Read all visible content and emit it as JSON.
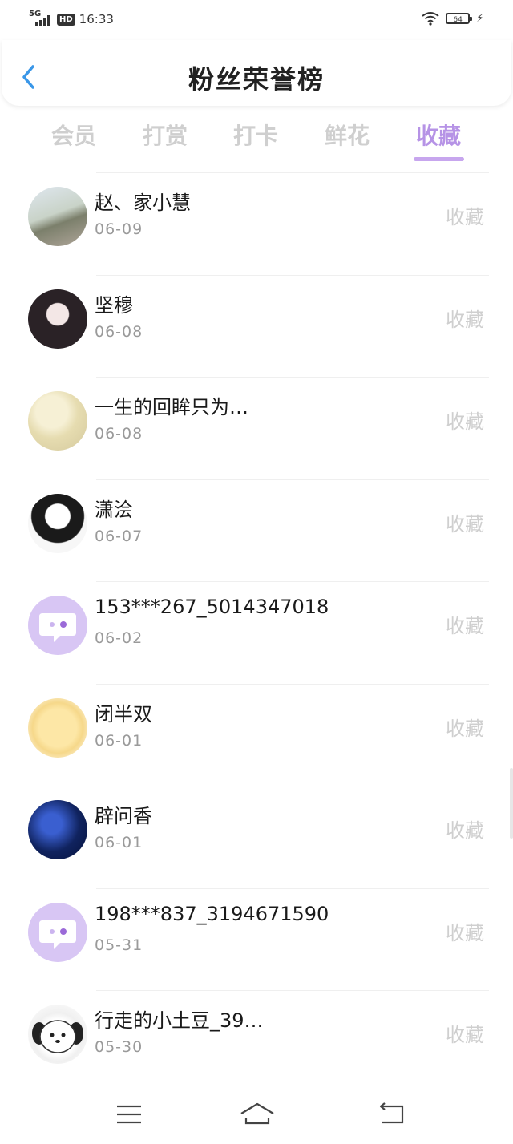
{
  "status_bar": {
    "network": "5G",
    "hd": "HD",
    "time": "16:33",
    "battery": "64"
  },
  "header": {
    "title": "粉丝荣誉榜"
  },
  "tabs": [
    {
      "label": "会员"
    },
    {
      "label": "打赏"
    },
    {
      "label": "打卡"
    },
    {
      "label": "鲜花"
    },
    {
      "label": "收藏"
    }
  ],
  "active_tab": "收藏",
  "colors": {
    "accent": "#b693e6",
    "back_arrow": "#3a97e8",
    "inactive_text": "#cfcfcf"
  },
  "fans": [
    {
      "name": "赵、家小慧",
      "date": "06-09",
      "action": "收藏",
      "avatar_icon": "group-photo-avatar"
    },
    {
      "name": "坚穆",
      "date": "06-08",
      "action": "收藏",
      "avatar_icon": "anime-girl-avatar"
    },
    {
      "name": "一生的回眸只为…",
      "date": "06-08",
      "action": "收藏",
      "avatar_icon": "tree-painting-avatar"
    },
    {
      "name": "潇浍",
      "date": "06-07",
      "action": "收藏",
      "avatar_icon": "anime-boy-avatar"
    },
    {
      "name": "153***267_5014347018",
      "date": "06-02",
      "action": "收藏",
      "avatar_icon": "chat-bubble-avatar"
    },
    {
      "name": "闭半双",
      "date": "06-01",
      "action": "收藏",
      "avatar_icon": "cartoon-bear-avatar"
    },
    {
      "name": "辟问香",
      "date": "06-01",
      "action": "收藏",
      "avatar_icon": "night-sky-avatar"
    },
    {
      "name": "198***837_3194671590",
      "date": "05-31",
      "action": "收藏",
      "avatar_icon": "chat-bubble-avatar"
    },
    {
      "name": "行走的小土豆_39…",
      "date": "05-30",
      "action": "收藏",
      "avatar_icon": "cartoon-dog-avatar"
    }
  ]
}
